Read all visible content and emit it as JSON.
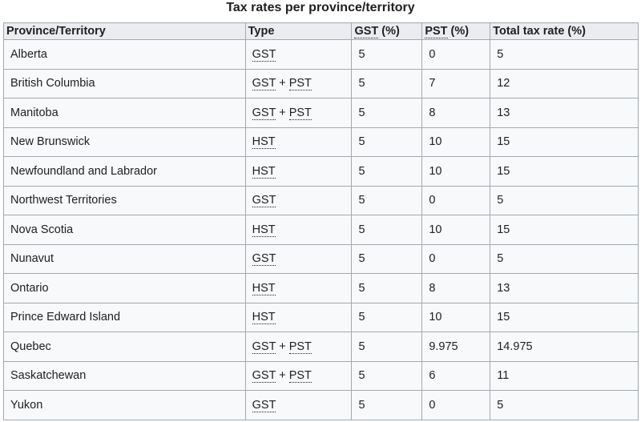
{
  "caption": "Tax rates per province/territory",
  "headers": {
    "province": "Province/Territory",
    "type": "Type",
    "gst_abbr": "GST",
    "gst_suffix": " (%)",
    "pst_abbr": "PST",
    "pst_suffix": " (%)",
    "total": "Total tax rate (%)"
  },
  "rows": [
    {
      "province": "Alberta",
      "type": [
        "GST"
      ],
      "gst": "5",
      "pst": "0",
      "total": "5"
    },
    {
      "province": "British Columbia",
      "type": [
        "GST",
        "PST"
      ],
      "gst": "5",
      "pst": "7",
      "total": "12"
    },
    {
      "province": "Manitoba",
      "type": [
        "GST",
        "PST"
      ],
      "gst": "5",
      "pst": "8",
      "total": "13"
    },
    {
      "province": "New Brunswick",
      "type": [
        "HST"
      ],
      "gst": "5",
      "pst": "10",
      "total": "15"
    },
    {
      "province": "Newfoundland and Labrador",
      "type": [
        "HST"
      ],
      "gst": "5",
      "pst": "10",
      "total": "15"
    },
    {
      "province": "Northwest Territories",
      "type": [
        "GST"
      ],
      "gst": "5",
      "pst": "0",
      "total": "5"
    },
    {
      "province": "Nova Scotia",
      "type": [
        "HST"
      ],
      "gst": "5",
      "pst": "10",
      "total": "15"
    },
    {
      "province": "Nunavut",
      "type": [
        "GST"
      ],
      "gst": "5",
      "pst": "0",
      "total": "5"
    },
    {
      "province": "Ontario",
      "type": [
        "HST"
      ],
      "gst": "5",
      "pst": "8",
      "total": "13"
    },
    {
      "province": "Prince Edward Island",
      "type": [
        "HST"
      ],
      "gst": "5",
      "pst": "10",
      "total": "15"
    },
    {
      "province": "Quebec",
      "type": [
        "GST",
        "PST"
      ],
      "gst": "5",
      "pst": "9.975",
      "total": "14.975"
    },
    {
      "province": "Saskatchewan",
      "type": [
        "GST",
        "PST"
      ],
      "gst": "5",
      "pst": "6",
      "total": "11"
    },
    {
      "province": "Yukon",
      "type": [
        "GST"
      ],
      "gst": "5",
      "pst": "0",
      "total": "5"
    }
  ],
  "type_separator": " + "
}
